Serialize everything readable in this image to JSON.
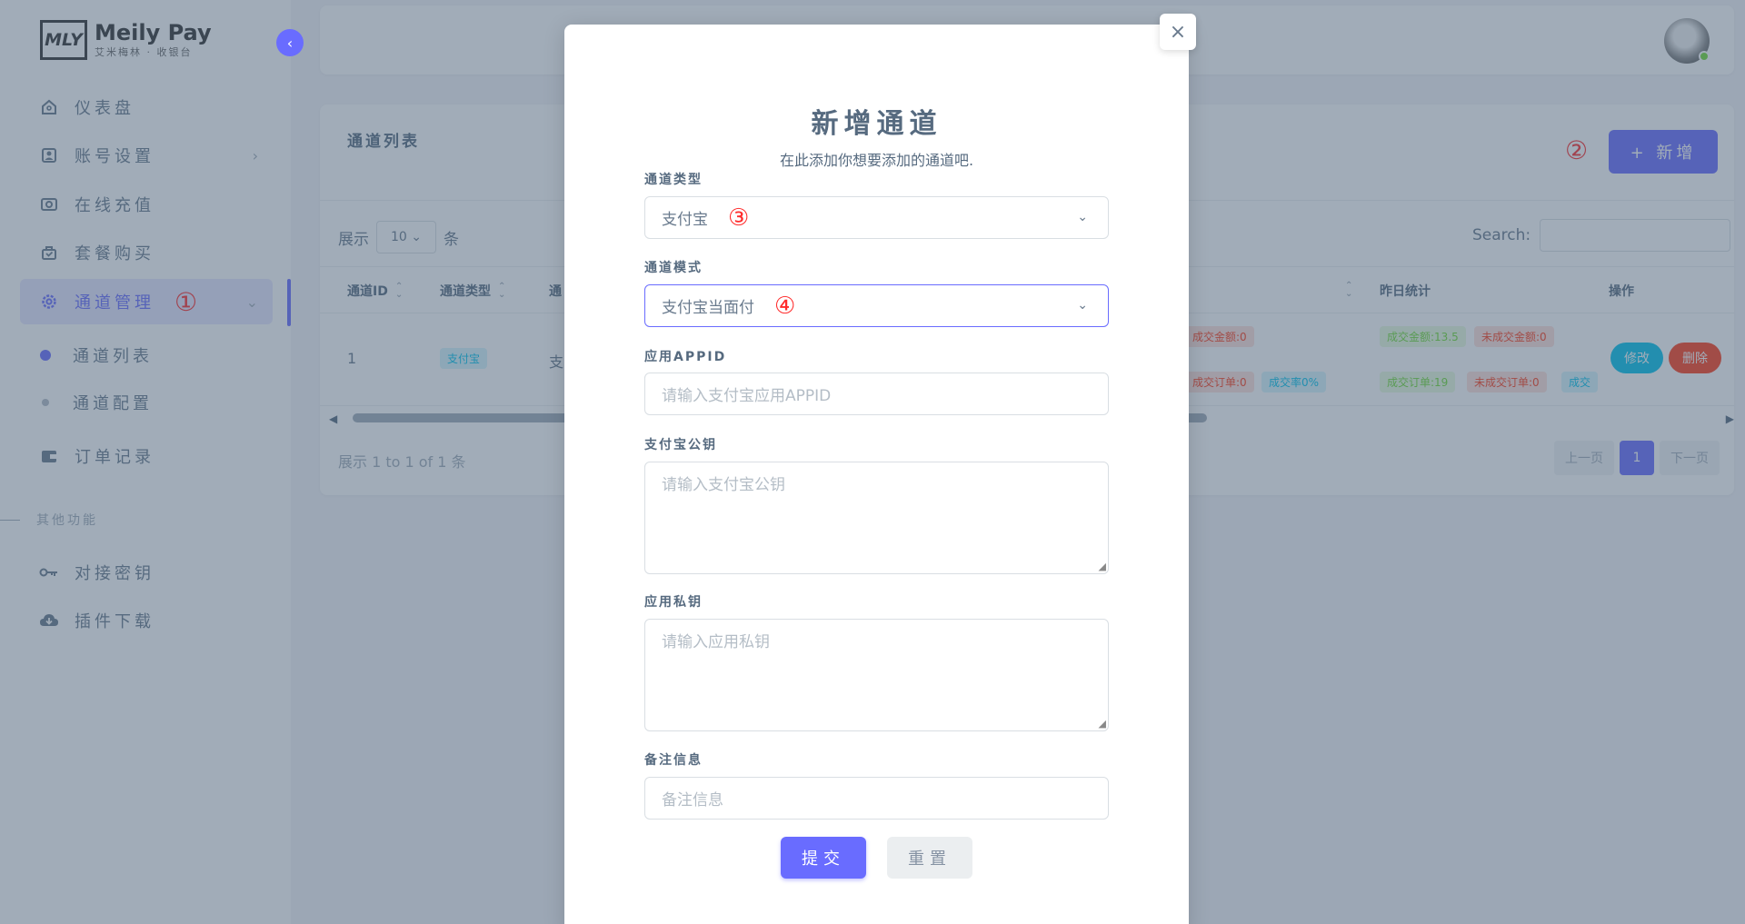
{
  "brand": {
    "logo_mark": "MLY",
    "name": "Meily Pay",
    "subtitle": "艾米梅林 · 收银台"
  },
  "sidebar": {
    "items": [
      {
        "label": "仪表盘",
        "icon": "home-icon"
      },
      {
        "label": "账号设置",
        "icon": "account-icon"
      },
      {
        "label": "在线充值",
        "icon": "recharge-icon"
      },
      {
        "label": "套餐购买",
        "icon": "package-icon"
      },
      {
        "label": "通道管理",
        "icon": "gear-icon",
        "annotation": "①"
      },
      {
        "label": "订单记录",
        "icon": "wallet-icon"
      },
      {
        "label": "对接密钥",
        "icon": "key-icon"
      },
      {
        "label": "插件下载",
        "icon": "cloud-download-icon"
      }
    ],
    "sub_items": [
      {
        "label": "通道列表"
      },
      {
        "label": "通道配置"
      }
    ],
    "section_other": "其他功能"
  },
  "card": {
    "title": "通道列表",
    "add_button": "+ 新增",
    "add_annotation": "②",
    "show_prefix": "展示",
    "show_value": "10",
    "show_suffix": "条",
    "search_label": "Search:",
    "columns": [
      "通道ID",
      "通道类型",
      "通",
      "昨日统计",
      "操作"
    ],
    "row": {
      "id": "1",
      "type": "支付宝",
      "mode_partial": "支",
      "today_badges": [
        "成交金额:0",
        "成交订单:0",
        "成交率0%"
      ],
      "yesterday_badges": [
        "成交金额:13.5",
        "未成交金额:0",
        "成交订单:19",
        "未成交订单:0",
        "成交"
      ],
      "edit_button": "修改",
      "delete_button": "删除"
    },
    "info": "展示 1 to 1 of 1 条",
    "pager": {
      "prev": "上一页",
      "current": "1",
      "next": "下一页"
    }
  },
  "modal": {
    "title": "新增通道",
    "subtitle": "在此添加你想要添加的通道吧.",
    "close": "×",
    "fields": {
      "type_label": "通道类型",
      "type_value": "支付宝",
      "type_annotation": "③",
      "mode_label": "通道模式",
      "mode_value": "支付宝当面付",
      "mode_annotation": "④",
      "appid_label": "应用APPID",
      "appid_placeholder": "请输入支付宝应用APPID",
      "pubkey_label": "支付宝公钥",
      "pubkey_placeholder": "请输入支付宝公钥",
      "privkey_label": "应用私钥",
      "privkey_placeholder": "请输入应用私钥",
      "remark_label": "备注信息",
      "remark_placeholder": "备注信息"
    },
    "submit": "提交",
    "reset": "重置"
  }
}
